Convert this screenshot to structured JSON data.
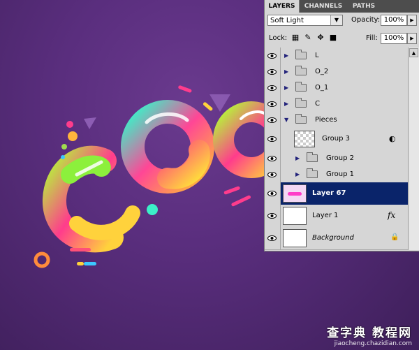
{
  "panel": {
    "tabs": [
      "LAYERS",
      "CHANNELS",
      "PATHS"
    ],
    "blend_mode": "Soft Light",
    "opacity_label": "Opacity:",
    "opacity_value": "100%",
    "lock_label": "Lock:",
    "fill_label": "Fill:",
    "fill_value": "100%"
  },
  "layers": [
    {
      "name": "L",
      "type": "group",
      "indent": 0,
      "expanded": false
    },
    {
      "name": "O_2",
      "type": "group",
      "indent": 0,
      "expanded": false
    },
    {
      "name": "O_1",
      "type": "group",
      "indent": 0,
      "expanded": false
    },
    {
      "name": "C",
      "type": "group",
      "indent": 0,
      "expanded": false
    },
    {
      "name": "Pieces",
      "type": "group",
      "indent": 0,
      "expanded": true
    },
    {
      "name": "Group 3",
      "type": "smart",
      "indent": 1
    },
    {
      "name": "Group 2",
      "type": "group",
      "indent": 1,
      "expanded": false
    },
    {
      "name": "Group 1",
      "type": "group",
      "indent": 1,
      "expanded": false
    },
    {
      "name": "Layer 67",
      "type": "layer",
      "selected": true
    },
    {
      "name": "Layer 1",
      "type": "layer",
      "fx": "fx"
    },
    {
      "name": "Background",
      "type": "background",
      "locked": true
    }
  ],
  "watermark": {
    "main": "查字典 教程网",
    "sub": "jiaocheng.chazidian.com"
  },
  "colors": {
    "canvas_bg": "#5a2e7e",
    "selected_row": "#0a246a",
    "panel_bg": "#d6d6d6"
  }
}
